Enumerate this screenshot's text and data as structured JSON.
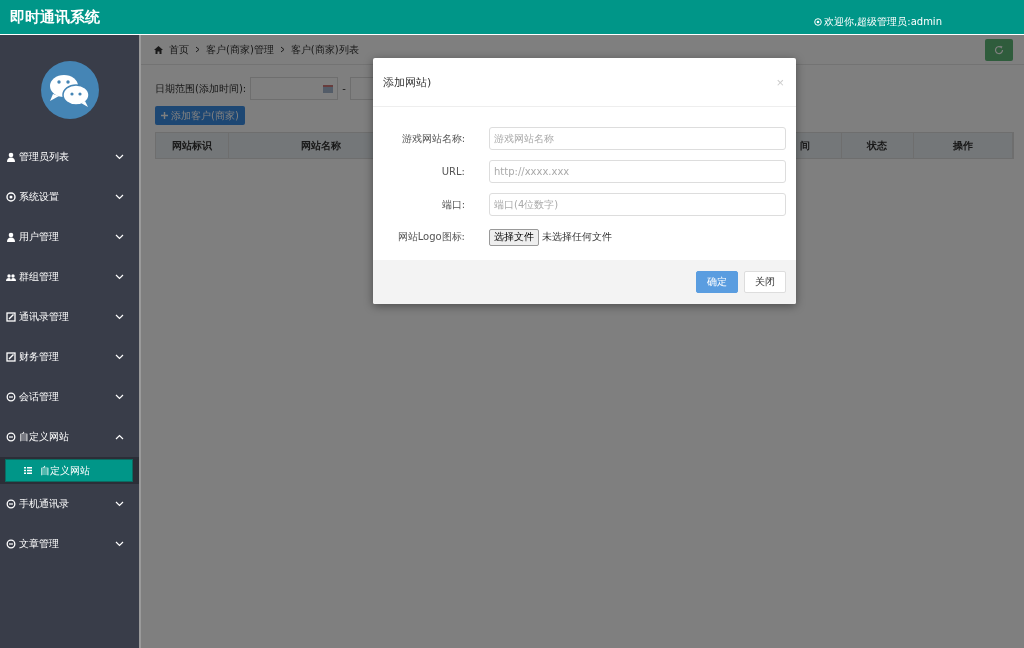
{
  "header": {
    "title": "即时通讯系统",
    "welcome": "欢迎你,超级管理员:admin"
  },
  "sidebar": {
    "items": [
      {
        "label": "管理员列表",
        "expanded": false
      },
      {
        "label": "系统设置",
        "expanded": false
      },
      {
        "label": "用户管理",
        "expanded": false
      },
      {
        "label": "群组管理",
        "expanded": false
      },
      {
        "label": "通讯录管理",
        "expanded": false
      },
      {
        "label": "财务管理",
        "expanded": false
      },
      {
        "label": "会话管理",
        "expanded": false
      },
      {
        "label": "自定义网站",
        "expanded": true,
        "children": [
          {
            "label": "自定义网站",
            "selected": true
          }
        ]
      },
      {
        "label": "手机通讯录",
        "expanded": false
      },
      {
        "label": "文章管理",
        "expanded": false
      }
    ]
  },
  "breadcrumb": [
    "首页",
    "客户(商家)管理",
    "客户(商家)列表"
  ],
  "filter": {
    "label": "日期范围(添加时间):",
    "separator": "-"
  },
  "add_button": "添加客户(商家)",
  "table": {
    "columns": [
      "网站标识",
      "网站名称",
      "间",
      "状态",
      "操作"
    ]
  },
  "dialog": {
    "title": "添加网站)",
    "close": "×",
    "fields": [
      {
        "kind": "text",
        "label": "游戏网站名称:",
        "placeholder": "游戏网站名称"
      },
      {
        "kind": "text",
        "label": "URL:",
        "placeholder": "http://xxxx.xxx"
      },
      {
        "kind": "text",
        "label": "端口:",
        "placeholder": "端口(4位数字)"
      },
      {
        "kind": "file",
        "label": "网站Logo图标:",
        "button": "选择文件",
        "status": "未选择任何文件"
      }
    ],
    "buttons": [
      {
        "label": "确定",
        "kind": "primary"
      },
      {
        "label": "关闭",
        "kind": "default"
      }
    ]
  }
}
